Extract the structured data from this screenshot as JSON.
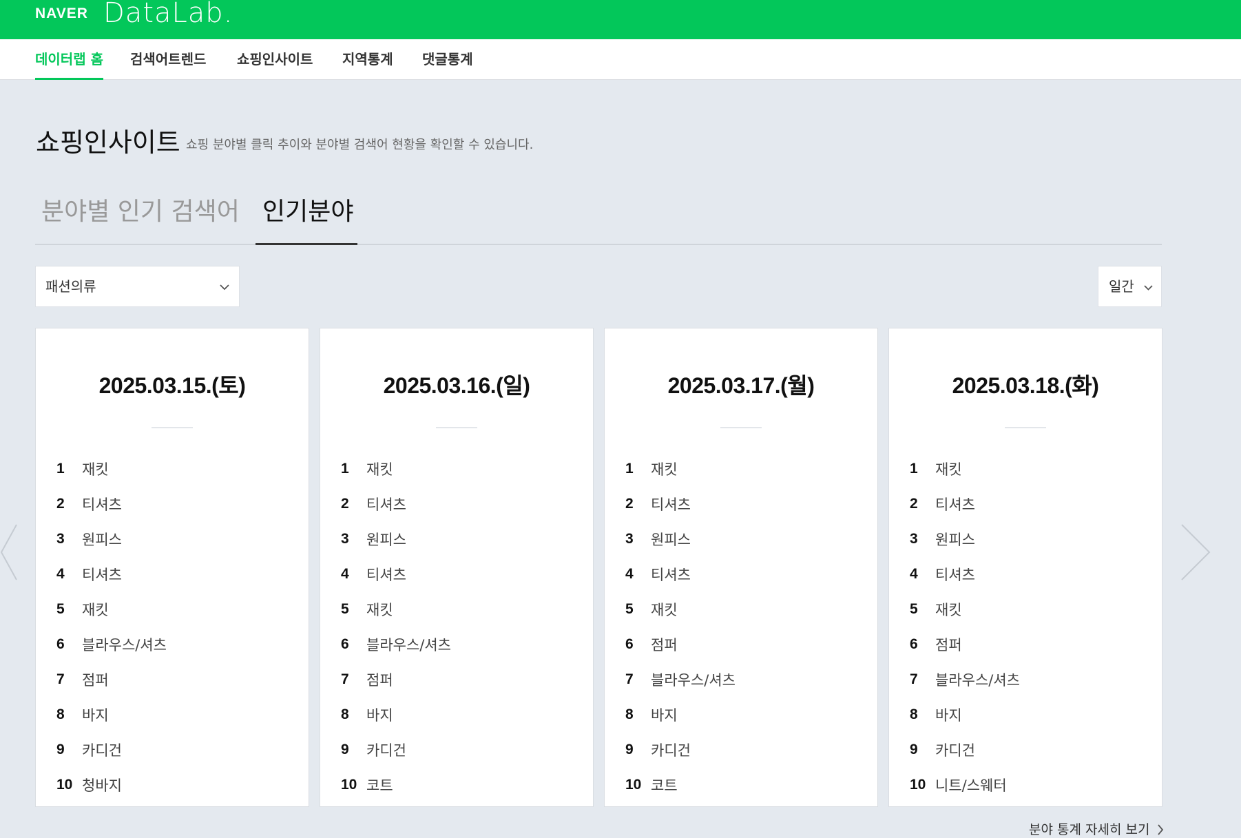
{
  "header": {
    "logo_naver": "NAVER",
    "logo_datalab": "DataLab."
  },
  "nav": {
    "items": [
      {
        "label": "데이터랩 홈",
        "active": true
      },
      {
        "label": "검색어트렌드",
        "active": false
      },
      {
        "label": "쇼핑인사이트",
        "active": false
      },
      {
        "label": "지역통계",
        "active": false
      },
      {
        "label": "댓글통계",
        "active": false
      }
    ]
  },
  "page": {
    "title": "쇼핑인사이트",
    "description": "쇼핑 분야별 클릭 추이와 분야별 검색어 현황을 확인할 수 있습니다."
  },
  "tabs": [
    {
      "label": "분야별 인기 검색어",
      "active": false
    },
    {
      "label": "인기분야",
      "active": true
    }
  ],
  "filters": {
    "category": "패션의류",
    "period": "일간"
  },
  "cards": [
    {
      "date": "2025.03.15.(토)",
      "ranks": [
        {
          "rank": "1",
          "keyword": "재킷"
        },
        {
          "rank": "2",
          "keyword": "티셔츠"
        },
        {
          "rank": "3",
          "keyword": "원피스"
        },
        {
          "rank": "4",
          "keyword": "티셔츠"
        },
        {
          "rank": "5",
          "keyword": "재킷"
        },
        {
          "rank": "6",
          "keyword": "블라우스/셔츠"
        },
        {
          "rank": "7",
          "keyword": "점퍼"
        },
        {
          "rank": "8",
          "keyword": "바지"
        },
        {
          "rank": "9",
          "keyword": "카디건"
        },
        {
          "rank": "10",
          "keyword": "청바지"
        }
      ]
    },
    {
      "date": "2025.03.16.(일)",
      "ranks": [
        {
          "rank": "1",
          "keyword": "재킷"
        },
        {
          "rank": "2",
          "keyword": "티셔츠"
        },
        {
          "rank": "3",
          "keyword": "원피스"
        },
        {
          "rank": "4",
          "keyword": "티셔츠"
        },
        {
          "rank": "5",
          "keyword": "재킷"
        },
        {
          "rank": "6",
          "keyword": "블라우스/셔츠"
        },
        {
          "rank": "7",
          "keyword": "점퍼"
        },
        {
          "rank": "8",
          "keyword": "바지"
        },
        {
          "rank": "9",
          "keyword": "카디건"
        },
        {
          "rank": "10",
          "keyword": "코트"
        }
      ]
    },
    {
      "date": "2025.03.17.(월)",
      "ranks": [
        {
          "rank": "1",
          "keyword": "재킷"
        },
        {
          "rank": "2",
          "keyword": "티셔츠"
        },
        {
          "rank": "3",
          "keyword": "원피스"
        },
        {
          "rank": "4",
          "keyword": "티셔츠"
        },
        {
          "rank": "5",
          "keyword": "재킷"
        },
        {
          "rank": "6",
          "keyword": "점퍼"
        },
        {
          "rank": "7",
          "keyword": "블라우스/셔츠"
        },
        {
          "rank": "8",
          "keyword": "바지"
        },
        {
          "rank": "9",
          "keyword": "카디건"
        },
        {
          "rank": "10",
          "keyword": "코트"
        }
      ]
    },
    {
      "date": "2025.03.18.(화)",
      "ranks": [
        {
          "rank": "1",
          "keyword": "재킷"
        },
        {
          "rank": "2",
          "keyword": "티셔츠"
        },
        {
          "rank": "3",
          "keyword": "원피스"
        },
        {
          "rank": "4",
          "keyword": "티셔츠"
        },
        {
          "rank": "5",
          "keyword": "재킷"
        },
        {
          "rank": "6",
          "keyword": "점퍼"
        },
        {
          "rank": "7",
          "keyword": "블라우스/셔츠"
        },
        {
          "rank": "8",
          "keyword": "바지"
        },
        {
          "rank": "9",
          "keyword": "카디건"
        },
        {
          "rank": "10",
          "keyword": "니트/스웨터"
        }
      ]
    }
  ],
  "footer": {
    "more_link": "분야 통계 자세히 보기"
  },
  "icons": {
    "prev": "chevron-left-icon",
    "next": "chevron-right-icon",
    "dropdown": "chevron-down-icon",
    "more": "chevron-right-icon"
  },
  "colors": {
    "brand_green": "#03c75a",
    "background": "#e4e9ef"
  }
}
